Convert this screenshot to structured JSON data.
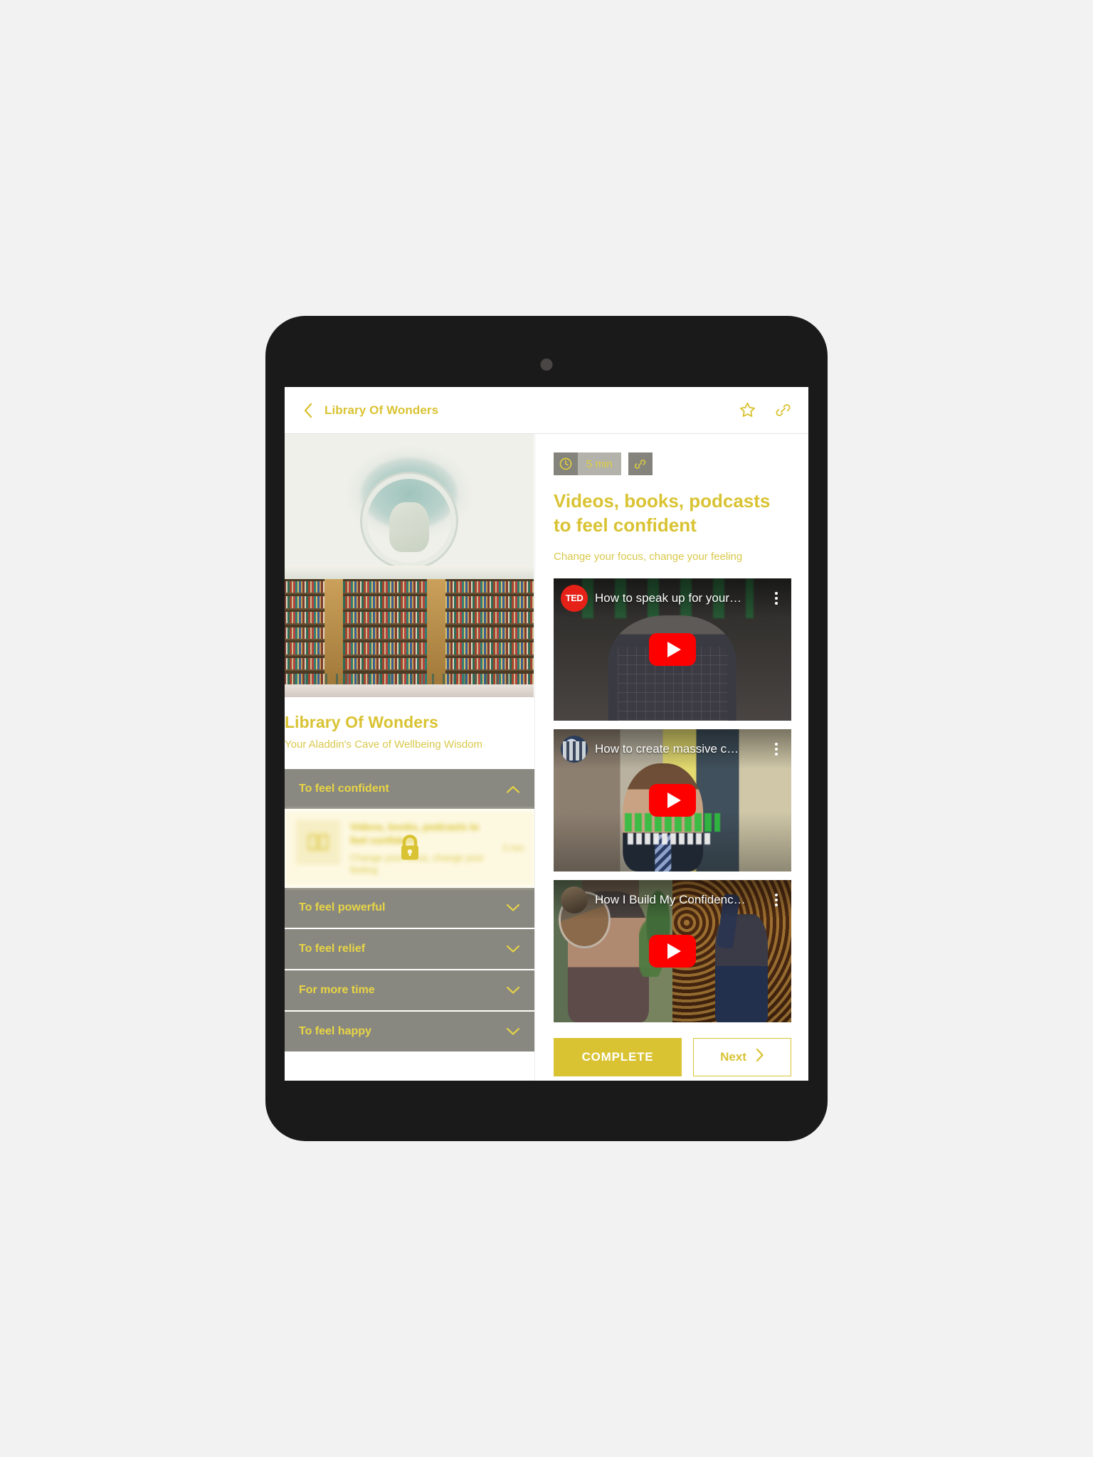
{
  "appbar": {
    "back_icon": "chevron-left-icon",
    "title": "Library Of Wonders",
    "favorite_icon": "star-outline-icon",
    "share_icon": "link-icon"
  },
  "left_pane": {
    "hero_image_alt": "domed library interior with bookshelves",
    "title": "Library Of Wonders",
    "subtitle": "Your Aladdin's Cave of Wellbeing Wisdom",
    "accordion": [
      {
        "label": "To feel confident",
        "expanded": true,
        "chevron": "chevron-up-icon",
        "locked": true,
        "lock_icon": "lock-icon",
        "item": {
          "thumb_icon": "book-icon",
          "title": "Videos, books, podcasts to feel confident",
          "subtitle": "Change your focus, change your feeling",
          "duration": "5 min"
        }
      },
      {
        "label": "To feel powerful",
        "expanded": false,
        "chevron": "chevron-down-icon"
      },
      {
        "label": "To feel relief",
        "expanded": false,
        "chevron": "chevron-down-icon"
      },
      {
        "label": "For more time",
        "expanded": false,
        "chevron": "chevron-down-icon"
      },
      {
        "label": "To feel happy",
        "expanded": false,
        "chevron": "chevron-down-icon"
      }
    ]
  },
  "right_pane": {
    "duration_icon": "clock-icon",
    "duration": "5 min",
    "share_icon": "link-icon",
    "title": "Videos, books, podcasts to feel confident",
    "subtitle": "Change your focus, change your feeling",
    "videos": [
      {
        "channel_avatar": "ted-logo-icon",
        "channel_label": "TED",
        "title": "How to speak up for your…",
        "menu_icon": "kebab-menu-icon",
        "play_icon": "youtube-play-icon"
      },
      {
        "channel_avatar": "channel-avatar-icon",
        "channel_label": "",
        "title": "How to create massive c…",
        "menu_icon": "kebab-menu-icon",
        "play_icon": "youtube-play-icon"
      },
      {
        "channel_avatar": "channel-avatar-icon",
        "channel_label": "",
        "title": "How I Build My Confidenc…",
        "menu_icon": "kebab-menu-icon",
        "play_icon": "youtube-play-icon"
      }
    ],
    "complete_label": "COMPLETE",
    "next_label": "Next",
    "next_icon": "chevron-right-icon"
  },
  "colors": {
    "brand_yellow": "#d9c333",
    "accent_yellow": "#e8d544",
    "grey_header": "#898880",
    "youtube_red": "#ff0000",
    "device_black": "#1a1a1a",
    "page_background": "#f2f2f2"
  }
}
